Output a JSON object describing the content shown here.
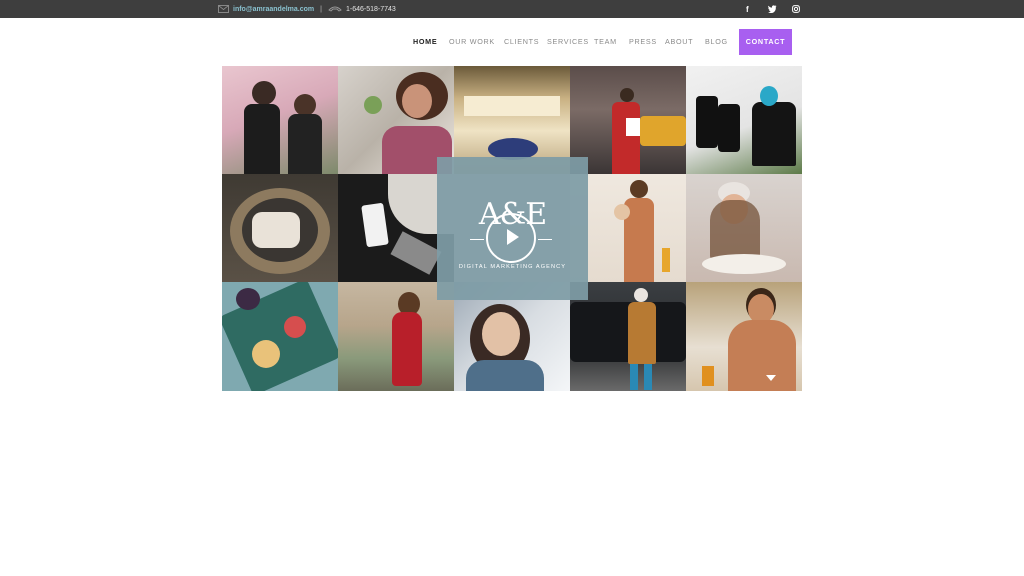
{
  "topbar": {
    "email": "info@amraandelma.com",
    "separator": "|",
    "phone": "1-646-518-7743",
    "mail_icon": "mail-icon",
    "phone_icon": "phone-icon",
    "social": [
      {
        "icon": "facebook-icon",
        "glyph": "f"
      },
      {
        "icon": "twitter-icon",
        "glyph": "🐦"
      },
      {
        "icon": "instagram-icon",
        "glyph": "◎"
      }
    ]
  },
  "nav": {
    "items": [
      {
        "label": "HOME"
      },
      {
        "label": "OUR WORK"
      },
      {
        "label": "CLIENTS"
      },
      {
        "label": "SERVICES"
      },
      {
        "label": "TEAM"
      },
      {
        "label": "PRESS"
      },
      {
        "label": "ABOUT"
      },
      {
        "label": "BLOG"
      }
    ],
    "contact": "CONTACT",
    "accent": "#a85ff0"
  },
  "hero": {
    "logo_text": "A&E",
    "tagline": "DIGITAL MARKETING AGENCY",
    "play_icon": "play-icon",
    "scroll_icon": "chevron-down-icon"
  },
  "colors": {
    "topbar": "#3e3e3e",
    "overlay": "#7e9ca6"
  }
}
